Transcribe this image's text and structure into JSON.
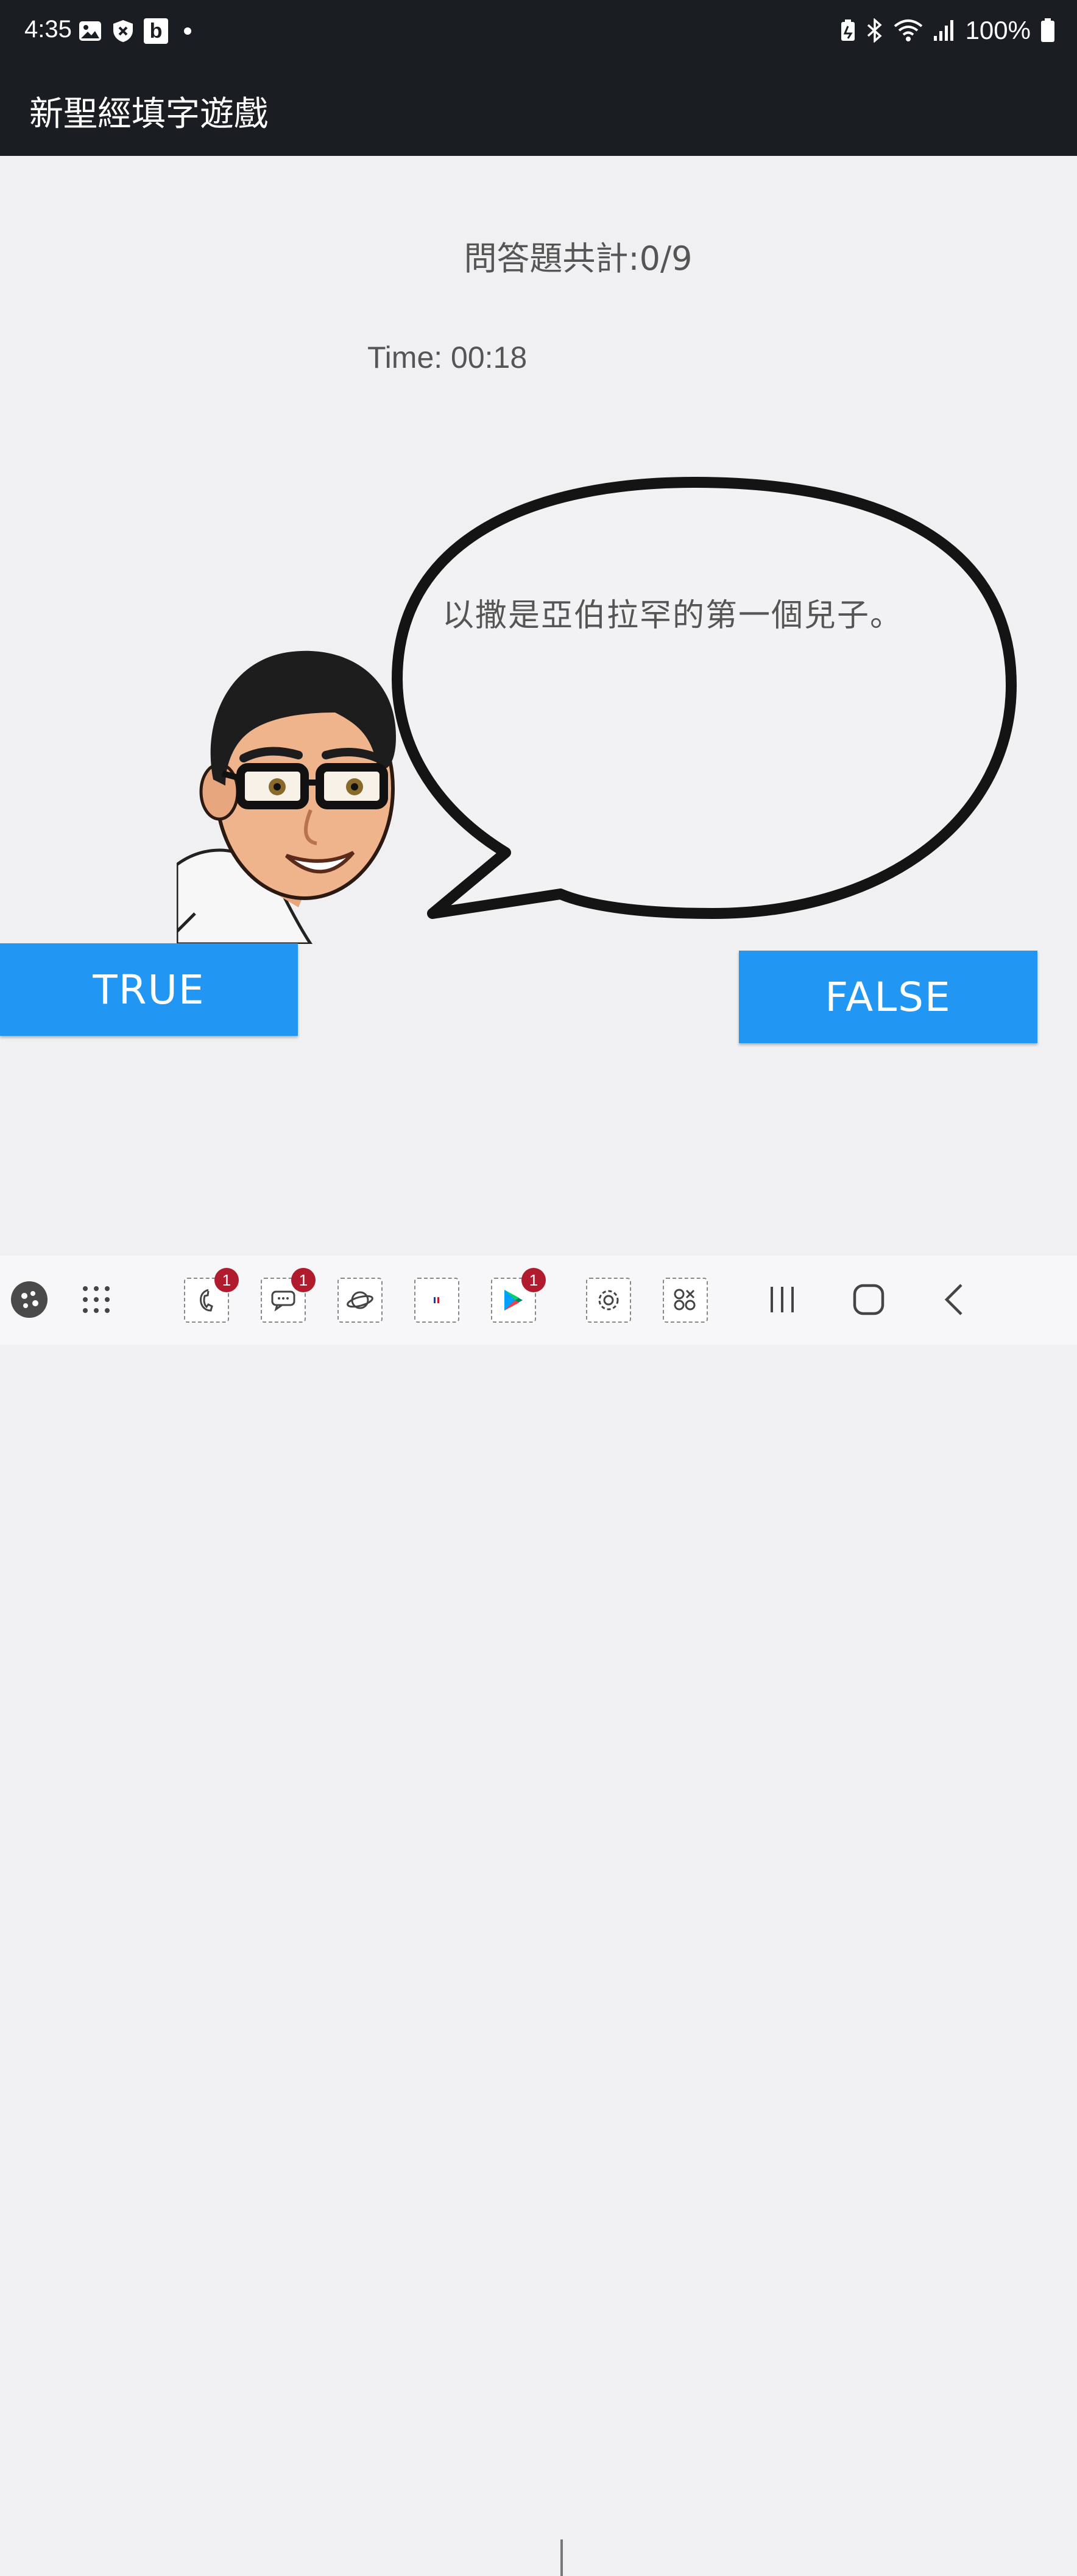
{
  "status_bar": {
    "time": "4:35",
    "left_icons": [
      "gallery-icon",
      "shield-icon",
      "b-app-icon",
      "notification-dot"
    ],
    "b_label": "b",
    "right_icons": [
      "battery-saver-icon",
      "bluetooth-icon",
      "wifi-icon",
      "signal-icon"
    ],
    "battery": "100%"
  },
  "app_bar": {
    "title": "新聖經填字遊戲"
  },
  "quiz": {
    "score": "問答題共計:0/9",
    "timer": "Time: 00:18",
    "question": "以撒是亞伯拉罕的第一個兒子。"
  },
  "buttons": {
    "true_label": "TRUE",
    "false_label": "FALSE"
  },
  "taskbar": {
    "apps": [
      {
        "name": "game-launcher-icon"
      },
      {
        "name": "app-drawer-icon"
      },
      {
        "name": "phone-icon",
        "badge": "1"
      },
      {
        "name": "messages-icon",
        "badge": "1"
      },
      {
        "name": "internet-icon"
      },
      {
        "name": "app-icon"
      },
      {
        "name": "play-store-icon",
        "badge": "1"
      },
      {
        "name": "settings-icon"
      },
      {
        "name": "apps-icon"
      }
    ],
    "nav": [
      "recents-icon",
      "home-icon",
      "back-icon"
    ]
  },
  "colors": {
    "bar": "#1a1d21",
    "accent": "#2196f3",
    "badge": "#b01b2e",
    "background": "#f0f0f3"
  }
}
